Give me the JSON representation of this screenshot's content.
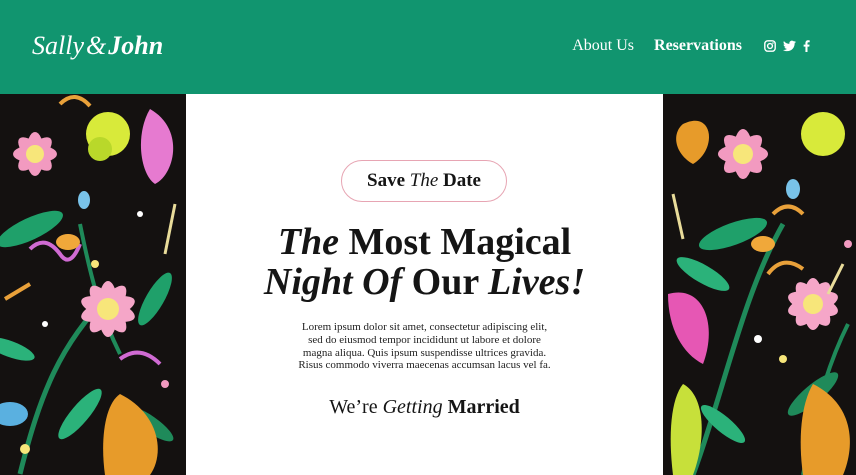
{
  "header": {
    "logo_first": "Sally",
    "logo_amp": "&",
    "logo_second": "John",
    "nav": {
      "about": "About Us",
      "reservations": "Reservations"
    },
    "social_icons": [
      "instagram-icon",
      "twitter-icon",
      "facebook-icon"
    ]
  },
  "hero": {
    "badge": {
      "part1": "Save",
      "part2": "The",
      "part3": "Date"
    },
    "headline": {
      "w1": "The",
      "w2": "Most Magical",
      "w3": "Night Of",
      "w4": "Our",
      "w5": "Lives!"
    },
    "body_lines": [
      "Lorem ipsum dolor sit amet, consectetur adipiscing elit,",
      "sed do eiusmod tempor incididunt ut labore et dolore",
      "magna aliqua. Quis ipsum suspendisse ultrices gravida.",
      "Risus commodo viverra maecenas accumsan lacus vel fa."
    ],
    "married": {
      "part1": "We’re",
      "part2": "Getting",
      "part3": "Married"
    }
  },
  "colors": {
    "header_bg": "#11956f",
    "pattern_bg": "#141110",
    "badge_border": "#e7a5b3"
  }
}
